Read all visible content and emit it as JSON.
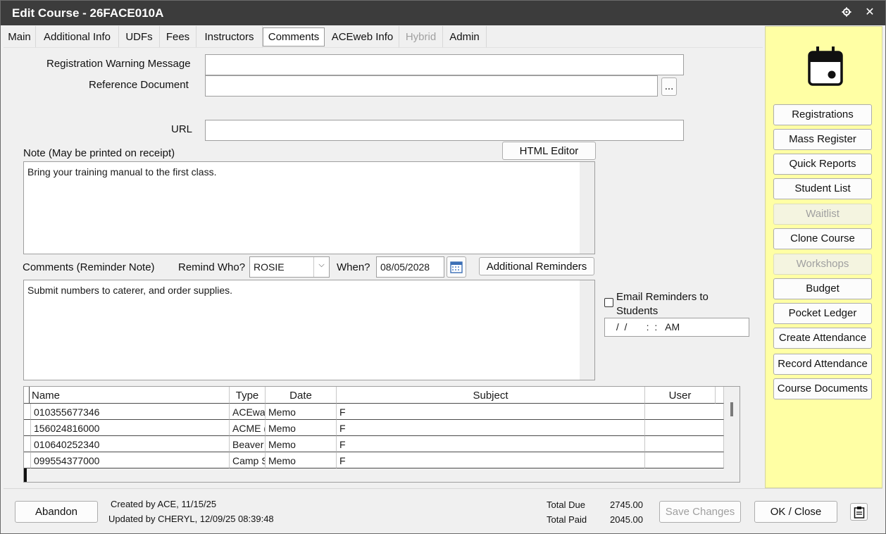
{
  "window": {
    "title": "Edit Course - 26FACE010A"
  },
  "tabs": [
    {
      "label": "Main"
    },
    {
      "label": "Additional Info"
    },
    {
      "label": "UDFs"
    },
    {
      "label": "Fees"
    },
    {
      "label": "Instructors"
    },
    {
      "label": "Comments"
    },
    {
      "label": "ACEweb Info"
    },
    {
      "label": "Hybrid"
    },
    {
      "label": "Admin"
    }
  ],
  "form": {
    "reg_warning_label": "Registration Warning Message",
    "reg_warning_value": "",
    "ref_doc_label": "Reference Document",
    "ref_doc_value": "",
    "browse_label": "...",
    "url_label": "URL",
    "url_value": "",
    "note_label": "Note (May be printed on receipt)",
    "html_editor_label": "HTML Editor",
    "note_value": "Bring your training manual to the first class.",
    "comments_label": "Comments (Reminder Note)",
    "remind_who_label": "Remind Who?",
    "remind_who_value": "ROSIE",
    "when_label": "When?",
    "when_value": "08/05/2028",
    "additional_reminders_label": "Additional Reminders",
    "comments_value": "Submit numbers to caterer, and order supplies.",
    "email_reminders_label": "Email Reminders to Students",
    "email_datetime_value": " /  /       :  :   AM"
  },
  "grid": {
    "columns": [
      "Name",
      "Type",
      "Date",
      "Subject",
      "User"
    ],
    "rows": [
      {
        "name": "010355677346",
        "type": "ACEwa",
        "date": "Memo",
        "subject": "F",
        "user": ""
      },
      {
        "name": "156024816000",
        "type": "ACME (",
        "date": "Memo",
        "subject": "F",
        "user": ""
      },
      {
        "name": "010640252340",
        "type": "Beaver",
        "date": "Memo",
        "subject": "F",
        "user": ""
      },
      {
        "name": "099554377000",
        "type": "Camp S",
        "date": "Memo",
        "subject": "F",
        "user": ""
      }
    ]
  },
  "side": {
    "buttons": [
      {
        "label": "Registrations",
        "enabled": true
      },
      {
        "label": "Mass Register",
        "enabled": true
      },
      {
        "label": "Quick Reports",
        "enabled": true
      },
      {
        "label": "Student List",
        "enabled": true
      },
      {
        "label": "Waitlist",
        "enabled": false
      },
      {
        "label": "Clone Course",
        "enabled": true
      },
      {
        "label": "Workshops",
        "enabled": false
      },
      {
        "label": "Budget",
        "enabled": true
      },
      {
        "label": "Pocket Ledger",
        "enabled": true
      },
      {
        "label": "Create Attendance",
        "enabled": true
      },
      {
        "label": "Record Attendance",
        "enabled": true
      },
      {
        "label": "Course Documents",
        "enabled": true
      }
    ]
  },
  "footer": {
    "abandon_label": "Abandon",
    "created_text": "Created by ACE, 11/15/25",
    "updated_text": "Updated by CHERYL, 12/09/25 08:39:48",
    "total_due_label": "Total Due",
    "total_due_value": "2745.00",
    "total_paid_label": "Total Paid",
    "total_paid_value": "2045.00",
    "save_label": "Save Changes",
    "ok_label": "OK / Close"
  }
}
